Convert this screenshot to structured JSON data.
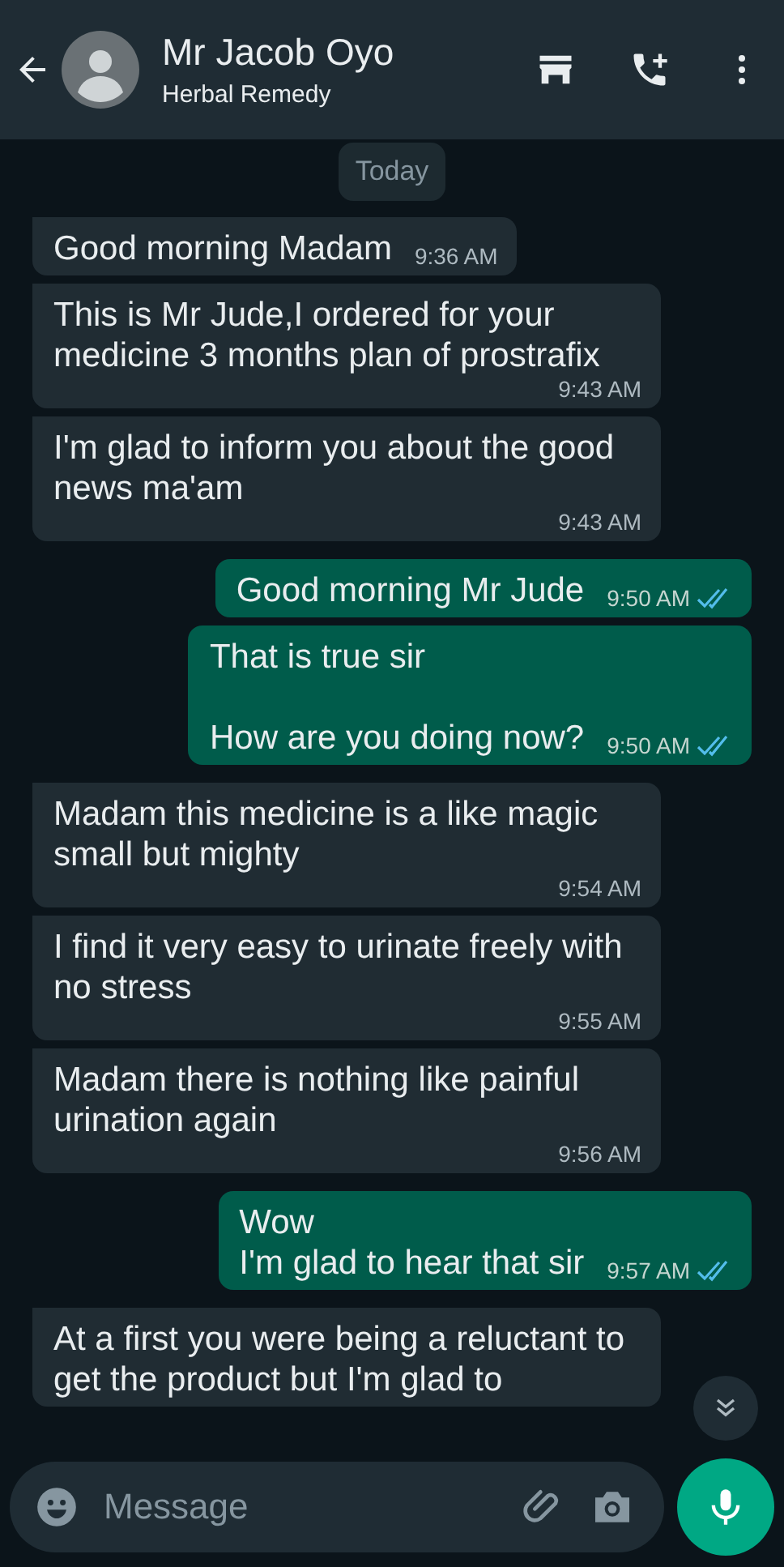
{
  "header": {
    "name": "Mr Jacob Oyo",
    "subtitle": "Herbal Remedy"
  },
  "date_chip": "Today",
  "messages": [
    {
      "kind": "received",
      "text": "Good morning Madam",
      "time": "9:36 AM"
    },
    {
      "kind": "received",
      "text": "This is Mr Jude,I ordered for your medicine 3 months plan of prostrafix",
      "time": "9:43 AM"
    },
    {
      "kind": "received",
      "text": "I'm glad to inform you about the good news ma'am",
      "time": "9:43 AM"
    },
    {
      "kind": "sent",
      "text": "Good morning Mr Jude",
      "time": "9:50 AM",
      "read": true
    },
    {
      "kind": "sent",
      "text": "That is true sir\n\nHow are you doing now?",
      "time": "9:50 AM",
      "read": true
    },
    {
      "kind": "received",
      "text": "Madam this medicine is a like magic small but mighty",
      "time": "9:54 AM"
    },
    {
      "kind": "received",
      "text": "I find it very easy to urinate freely with no stress",
      "time": "9:55 AM"
    },
    {
      "kind": "received",
      "text": "Madam there is nothing like painful urination again",
      "time": "9:56 AM"
    },
    {
      "kind": "sent",
      "text": "Wow\nI'm glad to hear that sir",
      "time": "9:57 AM",
      "read": true
    },
    {
      "kind": "received",
      "text": "At a first you were being a reluctant to get the product but I'm glad to"
    }
  ],
  "composer": {
    "placeholder": "Message"
  }
}
